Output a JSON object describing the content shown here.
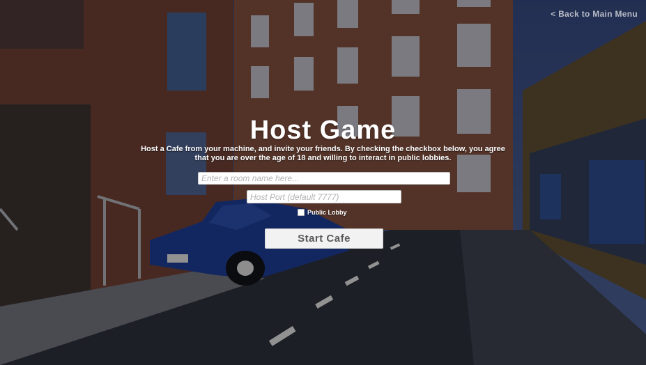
{
  "nav": {
    "back_label": "< Back to Main Menu"
  },
  "title": "Host Game",
  "description": "Host a Cafe from your machine, and invite your friends. By checking the checkbox below, you agree that you are over the age of 18 and willing to interact in public lobbies.",
  "room_input": {
    "value": "",
    "placeholder": "Enter a room name here..."
  },
  "port_input": {
    "value": "",
    "placeholder": "Host Port (default 7777)"
  },
  "public_lobby": {
    "label": "Public Lobby",
    "checked": false
  },
  "start_button": {
    "label": "Start Cafe"
  },
  "colors": {
    "title": "#ffffff",
    "button_bg": "#f2f2f2",
    "button_text": "#5a5a5a",
    "sky": "#3c4f80",
    "brick": "#7a4a38"
  }
}
